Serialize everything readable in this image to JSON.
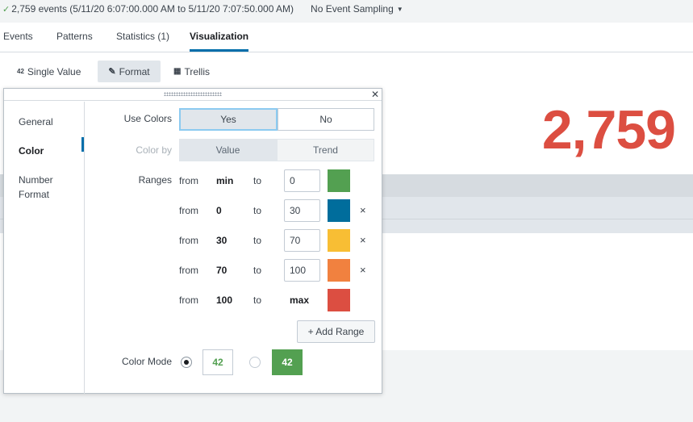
{
  "topbar": {
    "event_summary": "2,759 events (5/11/20 6:07:00.000 AM to 5/11/20 7:07:50.000 AM)",
    "sampling_label": "No Event Sampling",
    "check_icon": "check-icon",
    "caret_icon": "caret-down-icon"
  },
  "tabs": [
    {
      "label": "Events"
    },
    {
      "label": "Patterns"
    },
    {
      "label": "Statistics (1)"
    },
    {
      "label": "Visualization",
      "active": true
    }
  ],
  "viz_toolbar": {
    "single_value": {
      "icon_text": "42",
      "label": "Single Value"
    },
    "format": {
      "icon": "pencil-icon",
      "label": "Format"
    },
    "trellis": {
      "icon": "grid-icon",
      "label": "Trellis"
    }
  },
  "single_value": {
    "display": "2,759",
    "color": "#dc4e41"
  },
  "format_panel": {
    "close_icon": "close-icon",
    "sections": [
      "General",
      "Color",
      "Number Format"
    ],
    "active_section": "Color",
    "use_colors": {
      "label": "Use Colors",
      "options": [
        "Yes",
        "No"
      ],
      "selected": "Yes"
    },
    "color_by": {
      "label": "Color by",
      "options": [
        "Value",
        "Trend"
      ],
      "selected": "Value"
    },
    "ranges_label": "Ranges",
    "ranges": [
      {
        "from_word": "from",
        "from": "min",
        "to_word": "to",
        "to": "0",
        "color": "#53a051",
        "removable": false
      },
      {
        "from_word": "from",
        "from": "0",
        "to_word": "to",
        "to": "30",
        "color": "#006d9c",
        "removable": true
      },
      {
        "from_word": "from",
        "from": "30",
        "to_word": "to",
        "to": "70",
        "color": "#f8be34",
        "removable": true
      },
      {
        "from_word": "from",
        "from": "70",
        "to_word": "to",
        "to": "100",
        "color": "#f1813f",
        "removable": true
      },
      {
        "from_word": "from",
        "from": "100",
        "to_word": "to",
        "to": "max",
        "color": "#dc4e41",
        "removable": false
      }
    ],
    "remove_symbol": "×",
    "add_range_label": "+ Add Range",
    "color_mode": {
      "label": "Color Mode",
      "options": [
        {
          "sample": "42",
          "style": "text-color",
          "text_color": "#53a051"
        },
        {
          "sample": "42",
          "style": "background",
          "background": "#53a051",
          "text_color": "#ffffff"
        }
      ],
      "selected": 0
    }
  }
}
